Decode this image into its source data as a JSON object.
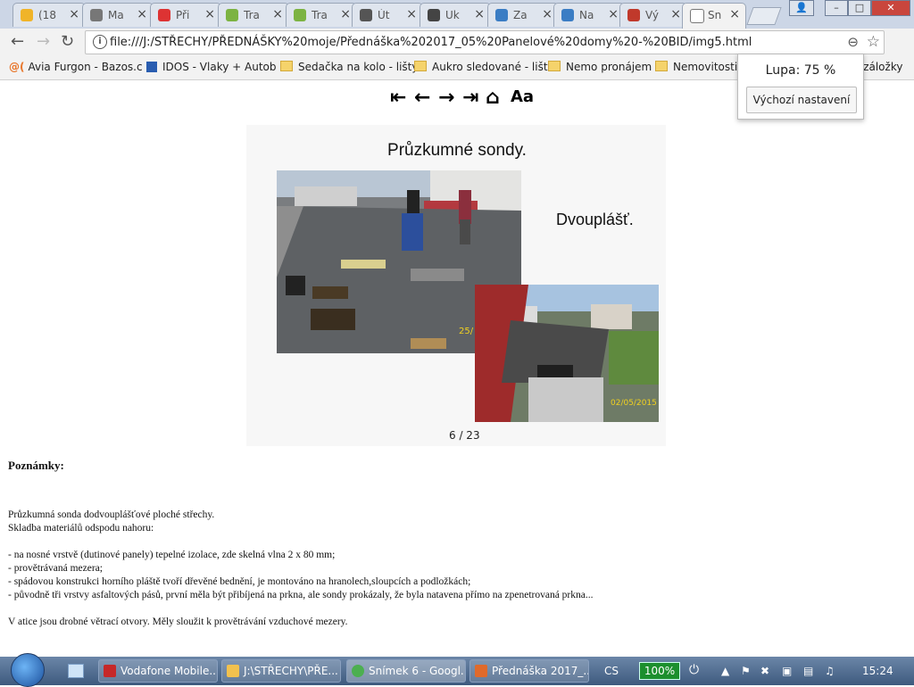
{
  "browser": {
    "tabs": [
      {
        "label": "(18",
        "icon": "mail-icon",
        "color": "#f0b429"
      },
      {
        "label": "Ma",
        "icon": "envelope-icon",
        "color": "#777777"
      },
      {
        "label": "Při",
        "icon": "seznam-icon",
        "color": "#d33"
      },
      {
        "label": "Tra",
        "icon": "m-icon",
        "color": "#7cb342"
      },
      {
        "label": "Tra",
        "icon": "m-icon",
        "color": "#7cb342"
      },
      {
        "label": "Út",
        "icon": "grid-icon",
        "color": "#555555"
      },
      {
        "label": "Uk",
        "icon": "h-icon",
        "color": "#444444"
      },
      {
        "label": "Za",
        "icon": "wave-icon",
        "color": "#3b7dc4"
      },
      {
        "label": "Na",
        "icon": "wave-icon",
        "color": "#3b7dc4"
      },
      {
        "label": "Vý",
        "icon": "globe-icon",
        "color": "#c0392b"
      },
      {
        "label": "Sn",
        "icon": "page-icon",
        "color": "#ffffff",
        "active": true
      }
    ],
    "url": "file:///J:/STŘECHY/PŘEDNÁŠKY%20moje/Přednáška%202017_05%20Panelové%20domy%20-%20BID/img5.html",
    "bookmarks": [
      "Avia Furgon - Bazos.c",
      "IDOS - Vlaky + Autob",
      "Sedačka na kolo - lišty",
      "Aukro sledované - lišt",
      "Nemo pronájem",
      "Nemovitosti",
      "é záložky"
    ],
    "zoom_label": "Lupa: 75 %",
    "zoom_reset": "Výchozí nastavení"
  },
  "slide": {
    "nav_font": "Aa",
    "title": "Průzkumné sondy.",
    "side_text": "Dvouplášť.",
    "photo1_stamp": "25/",
    "photo2_stamp": "02/05/2015",
    "page_number": "6 / 23"
  },
  "notes": {
    "heading": "Poznámky:",
    "lines": [
      "Průzkumná sonda dodvouplášťové ploché střechy.",
      "Skladba materiálů odspodu nahoru:",
      "- na nosné vrstvě (dutinové panely) tepelné izolace, zde skelná vlna 2 x 80 mm;",
      "- provětrávaná mezera;",
      "- spádovou konstrukci horního pláště tvoří dřevěné bednění, je montováno na hranolech,sloupcích a podložkách;",
      "- původně tři vrstvy asfaltových pásů, první měla být přibíjená na prkna, ale sondy prokázaly, že byla natavena přímo na zpenetrovaná prkna...",
      "V atice jsou drobné větrací otvory. Měly sloužit k provětrávání vzduchové mezery."
    ]
  },
  "taskbar": {
    "items": [
      {
        "label": "Vodafone Mobile...",
        "color": "#c62828"
      },
      {
        "label": "J:\\STŘECHY\\PŘE...",
        "color": "#f2c14e"
      },
      {
        "label": "Snímek 6 - Googl...",
        "color": "#4caf50"
      },
      {
        "label": "Přednáška 2017_...",
        "color": "#e06a2b"
      }
    ],
    "lang": "CS",
    "battery": "100%",
    "clock": "15:24"
  }
}
